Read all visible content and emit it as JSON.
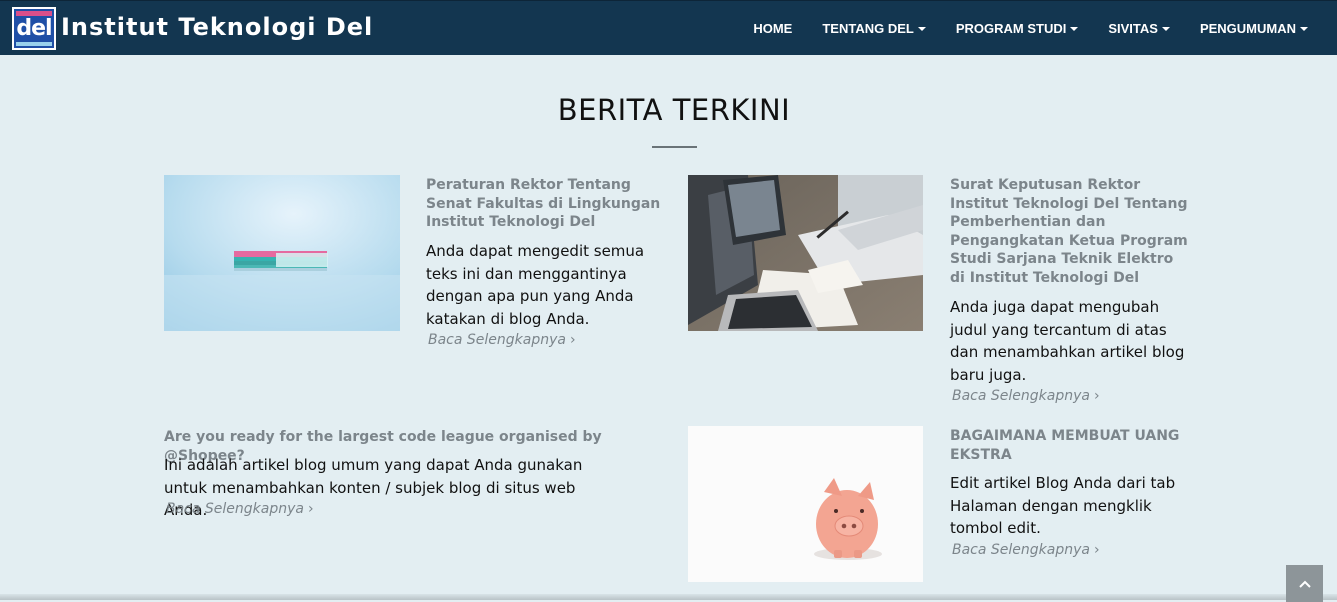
{
  "header": {
    "logo_text": "del",
    "brand": "Institut Teknologi Del",
    "nav": [
      {
        "label": "HOME",
        "dropdown": false
      },
      {
        "label": "TENTANG DEL",
        "dropdown": true
      },
      {
        "label": "PROGRAM STUDI",
        "dropdown": true
      },
      {
        "label": "SIVITAS",
        "dropdown": true
      },
      {
        "label": "PENGUMUMAN",
        "dropdown": true
      }
    ]
  },
  "section": {
    "title": "BERITA TERKINI"
  },
  "articles": [
    {
      "title": "Peraturan Rektor Tentang Senat Fakultas di Lingkungan Institut Teknologi Del",
      "excerpt": "Anda dapat mengedit semua teks ini dan menggantinya dengan apa pun yang Anda katakan di blog Anda.",
      "read_more": "Baca Selengkapnya",
      "image": "book-on-table-image"
    },
    {
      "title": "Surat Keputusan Rektor Institut Teknologi Del Tentang Pemberhentian dan Pengangkatan Ketua Program Studi Sarjana Teknik Elektro di Institut Teknologi Del",
      "excerpt": "Anda juga dapat mengubah judul yang tercantum di atas dan menambahkan artikel blog baru juga.",
      "read_more": "Baca Selengkapnya",
      "image": "laptop-meeting-image"
    },
    {
      "title": "Are you ready for the largest code league organised by @Shopee?",
      "excerpt": "Ini adalah artikel blog umum yang dapat Anda gunakan untuk menambahkan konten / subjek blog di situs web Anda.",
      "read_more": "Baca Selengkapnya",
      "image": null
    },
    {
      "title": "BAGAIMANA MEMBUAT UANG EKSTRA",
      "excerpt": "Edit artikel Blog Anda dari tab Halaman dengan mengklik tombol edit.",
      "read_more": "Baca Selengkapnya",
      "image": "piggy-bank-image"
    }
  ],
  "colors": {
    "navbar": "#133650",
    "background": "#e3eef2",
    "headline": "#7c858b"
  },
  "icons": {
    "read_more": "chevron-right-icon",
    "nav_dropdown": "caret-down-icon",
    "back_to_top": "chevron-up-icon"
  }
}
